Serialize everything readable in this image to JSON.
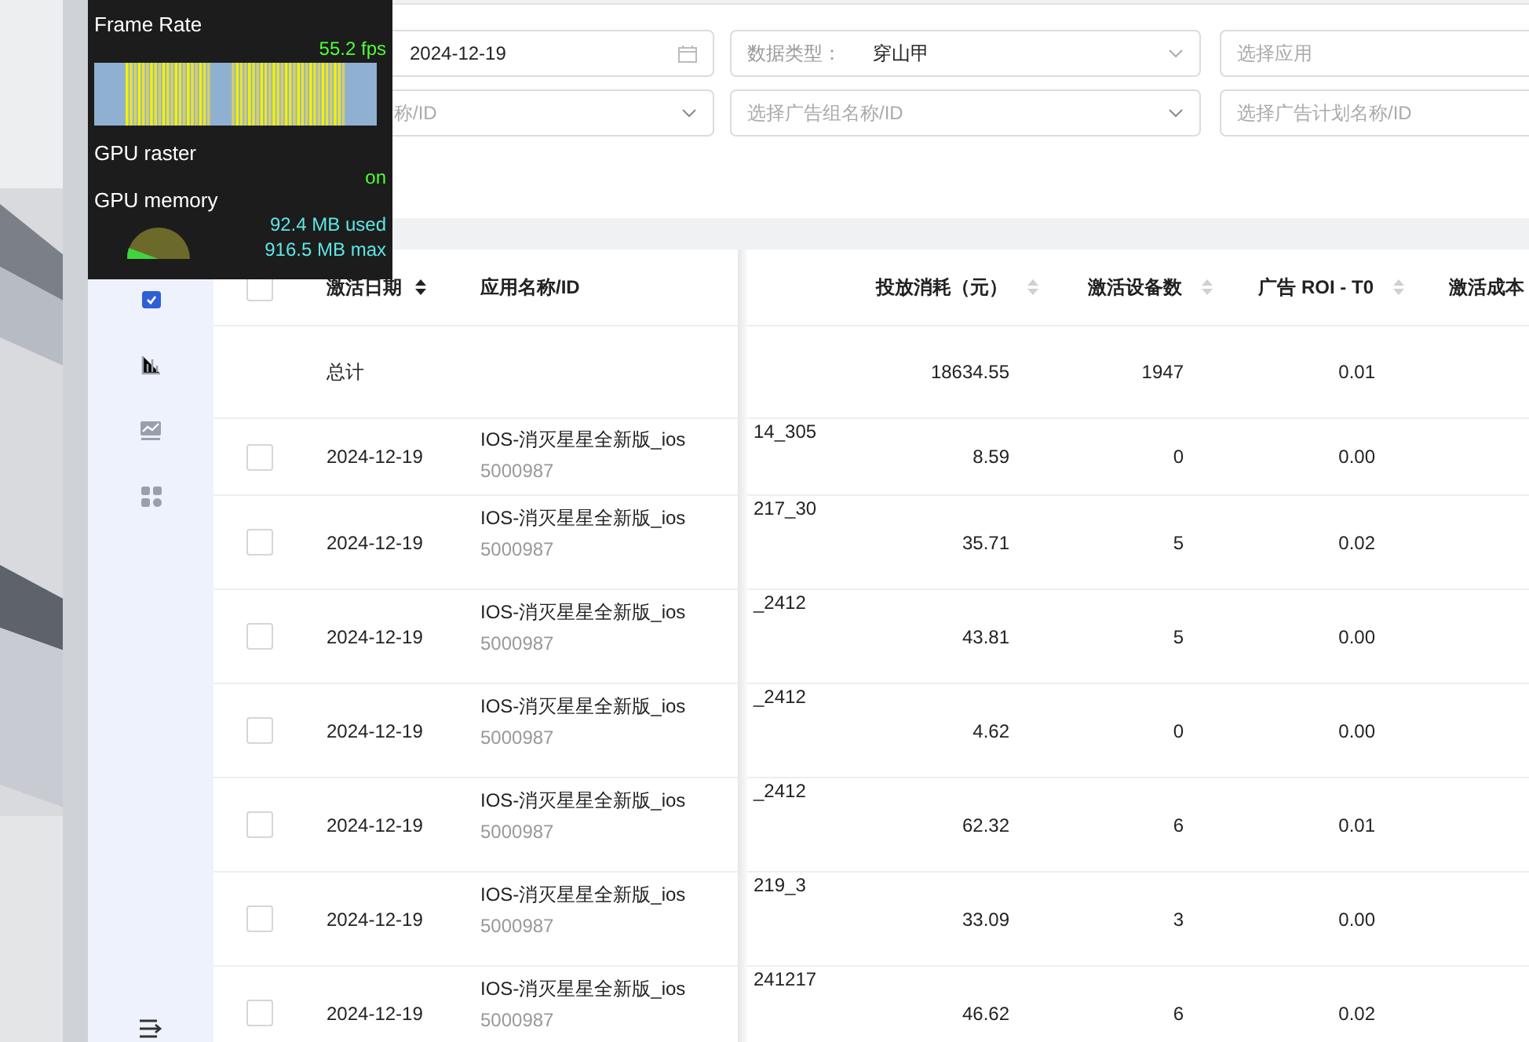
{
  "perf_overlay": {
    "title": "Frame Rate",
    "fps": "55.2 fps",
    "raster_label": "GPU raster",
    "raster_state": "on",
    "memory_label": "GPU memory",
    "memory_used": "92.4 MB used",
    "memory_max": "916.5 MB max"
  },
  "sidebar": {
    "items": [
      {
        "kind": "calendar",
        "selected": true
      },
      {
        "kind": "bars",
        "selected": false
      },
      {
        "kind": "trend",
        "selected": false
      },
      {
        "kind": "grid",
        "selected": false
      }
    ]
  },
  "filters": {
    "date_end": "2024-12-19",
    "data_type_label": "数据类型：",
    "data_type_value": "穿山甲",
    "app_placeholder": "选择应用",
    "account_placeholder": "称/ID",
    "ad_group_placeholder": "选择广告组名称/ID",
    "ad_plan_placeholder": "选择广告计划名称/ID"
  },
  "table": {
    "select_all_checked": false,
    "columns": [
      {
        "label": "激活日期",
        "sortable": true,
        "sorted": true
      },
      {
        "label": "应用名称/ID"
      },
      {
        "label": "投放消耗（元）",
        "sortable": true,
        "sorted": false
      },
      {
        "label": "激活设备数",
        "sortable": true,
        "sorted": false
      },
      {
        "label": "广告 ROI - T0",
        "sortable": true,
        "sorted": false
      },
      {
        "label": "激活成本"
      }
    ],
    "total": {
      "label": "总计",
      "spend": "18634.55",
      "devices": "1947",
      "roi": "0.01"
    },
    "rows": [
      {
        "checked": false,
        "date": "2024-12-19",
        "app": "IOS-消灭星星全新版_ios",
        "app_id": "5000987",
        "column_3": "14_305",
        "spend": "8.59",
        "devices": "0",
        "roi": "0.00"
      },
      {
        "checked": false,
        "date": "2024-12-19",
        "app": "IOS-消灭星星全新版_ios",
        "app_id": "5000987",
        "column_3": "217_30",
        "spend": "35.71",
        "devices": "5",
        "roi": "0.02"
      },
      {
        "checked": false,
        "date": "2024-12-19",
        "app": "IOS-消灭星星全新版_ios",
        "app_id": "5000987",
        "column_3": "_2412",
        "spend": "43.81",
        "devices": "5",
        "roi": "0.00"
      },
      {
        "checked": false,
        "date": "2024-12-19",
        "app": "IOS-消灭星星全新版_ios",
        "app_id": "5000987",
        "column_3": "_2412",
        "spend": "4.62",
        "devices": "0",
        "roi": "0.00"
      },
      {
        "checked": false,
        "date": "2024-12-19",
        "app": "IOS-消灭星星全新版_ios",
        "app_id": "5000987",
        "column_3": "_2412",
        "spend": "62.32",
        "devices": "6",
        "roi": "0.01"
      },
      {
        "checked": false,
        "date": "2024-12-19",
        "app": "IOS-消灭星星全新版_ios",
        "app_id": "5000987",
        "column_3": "219_3",
        "spend": "33.09",
        "devices": "3",
        "roi": "0.00"
      },
      {
        "checked": false,
        "date": "2024-12-19",
        "app": "IOS-消灭星星全新版_ios",
        "app_id": "5000987",
        "column_3": "241217",
        "spend": "46.62",
        "devices": "6",
        "roi": "0.02"
      }
    ]
  }
}
